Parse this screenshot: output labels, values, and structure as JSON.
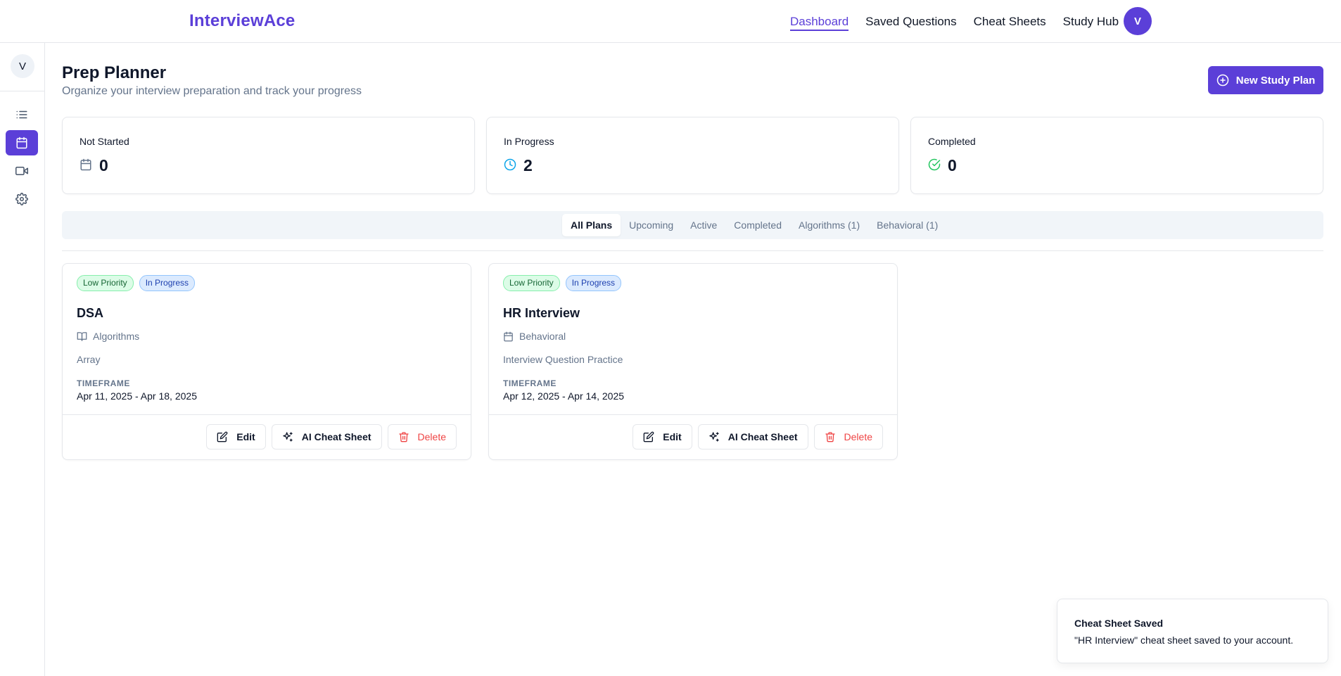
{
  "brand": "InterviewAce",
  "nav": {
    "links": [
      "Dashboard",
      "Saved Questions",
      "Cheat Sheets",
      "Study Hub"
    ],
    "active": "Dashboard",
    "avatar": "V"
  },
  "sidebar": {
    "avatar": "V",
    "items": [
      {
        "icon": "list-icon",
        "active": false
      },
      {
        "icon": "calendar-icon",
        "active": true
      },
      {
        "icon": "video-icon",
        "active": false
      },
      {
        "icon": "gear-icon",
        "active": false
      }
    ]
  },
  "header": {
    "title": "Prep Planner",
    "subtitle": "Organize your interview preparation and track your progress",
    "new_plan_label": "New Study Plan"
  },
  "stats": [
    {
      "label": "Not Started",
      "value": "0",
      "icon": "calendar-icon",
      "color": "#64748b"
    },
    {
      "label": "In Progress",
      "value": "2",
      "icon": "clock-icon",
      "color": "#0ea5e9"
    },
    {
      "label": "Completed",
      "value": "0",
      "icon": "check-circle-icon",
      "color": "#22c55e"
    }
  ],
  "tabs": [
    "All Plans",
    "Upcoming",
    "Active",
    "Completed",
    "Algorithms (1)",
    "Behavioral (1)"
  ],
  "active_tab": "All Plans",
  "plans": [
    {
      "priority": "Low Priority",
      "status": "In Progress",
      "title": "DSA",
      "category": "Algorithms",
      "category_icon": "book-icon",
      "description": "Array",
      "timeframe_label": "TIMEFRAME",
      "timeframe": "Apr 11, 2025 - Apr 18, 2025",
      "actions": {
        "edit": "Edit",
        "cheat": "AI Cheat Sheet",
        "delete": "Delete"
      }
    },
    {
      "priority": "Low Priority",
      "status": "In Progress",
      "title": "HR Interview",
      "category": "Behavioral",
      "category_icon": "calendar-icon",
      "description": "Interview Question Practice",
      "timeframe_label": "TIMEFRAME",
      "timeframe": "Apr 12, 2025 - Apr 14, 2025",
      "actions": {
        "edit": "Edit",
        "cheat": "AI Cheat Sheet",
        "delete": "Delete"
      }
    }
  ],
  "toast": {
    "title": "Cheat Sheet Saved",
    "message": "\"HR Interview\" cheat sheet saved to your account."
  },
  "colors": {
    "accent": "#5b3fd8",
    "danger": "#ef4444"
  }
}
